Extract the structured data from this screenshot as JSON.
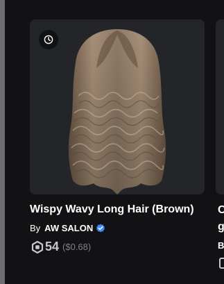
{
  "item": {
    "name": "Wispy Wavy Long Hair (Brown)",
    "by_label": "By",
    "creator": "AW SALON",
    "price": "54",
    "price_usd": "($0.68)",
    "badge_icon": "clock-icon",
    "currency_icon": "robux-icon",
    "verified_icon": "verified-badge-icon"
  },
  "next_item_peek": {
    "line1": "C",
    "line2": "g",
    "line3": "B"
  },
  "colors": {
    "background": "#121215",
    "thumbnail_bg": "#232528",
    "verified_blue": "#3b8bff",
    "hair_brown": "#9a8470"
  }
}
